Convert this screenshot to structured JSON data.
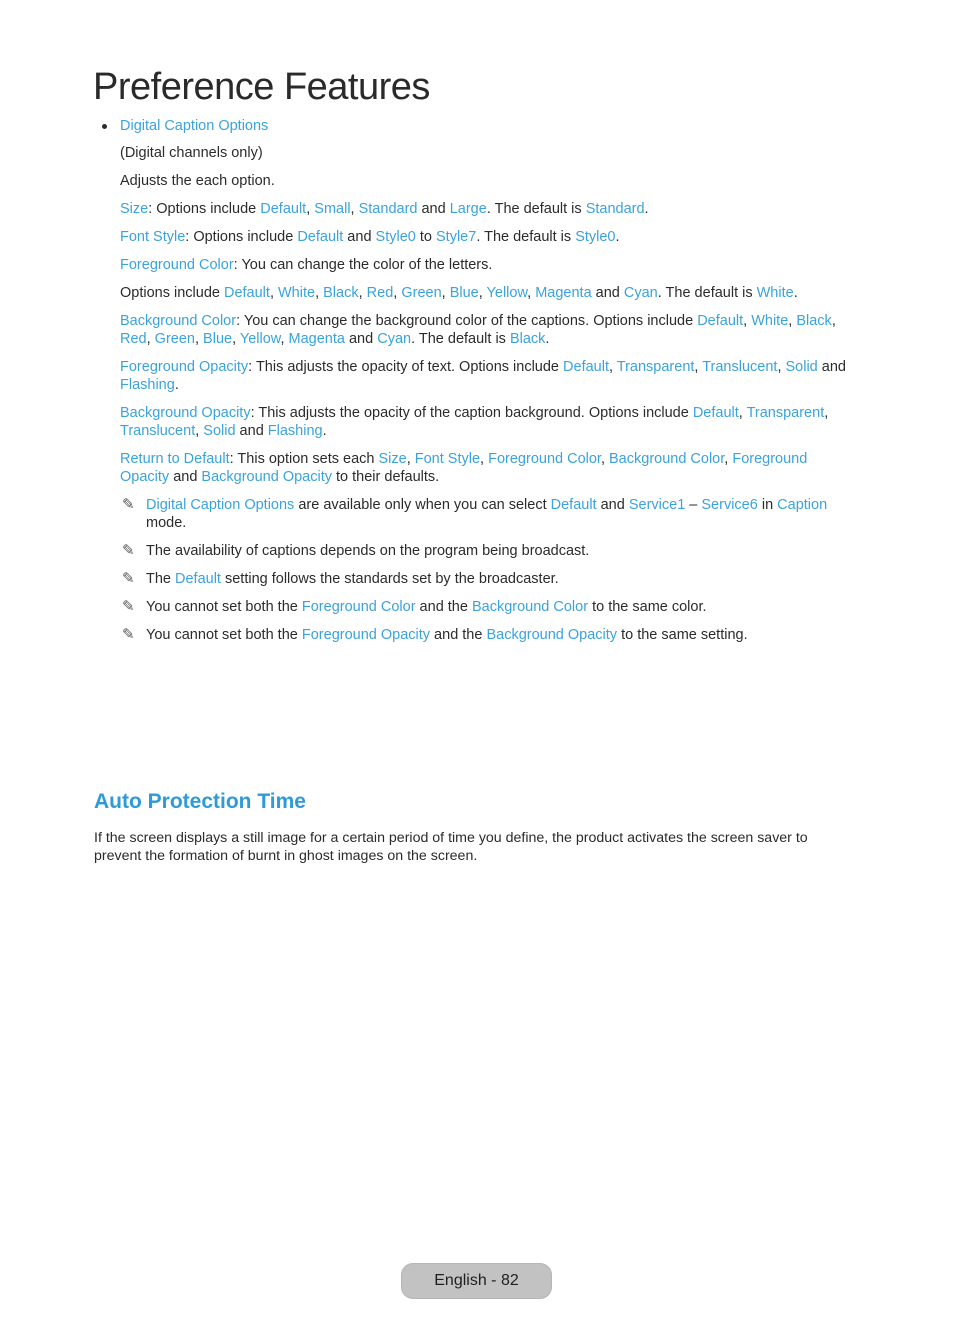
{
  "page": {
    "title": "Preference Features",
    "accent_color": "#3aa3dc",
    "heading_color": "#2f9ad8"
  },
  "bullet": {
    "label": "Digital Caption Options"
  },
  "paragraphs": [
    [
      {
        "t": "(Digital channels only)"
      }
    ],
    [
      {
        "t": "Adjusts the each option."
      }
    ],
    [
      {
        "t": "Size",
        "hl": true
      },
      {
        "t": ": Options include "
      },
      {
        "t": "Default",
        "hl": true
      },
      {
        "t": ", "
      },
      {
        "t": "Small",
        "hl": true
      },
      {
        "t": ", "
      },
      {
        "t": "Standard",
        "hl": true
      },
      {
        "t": " and "
      },
      {
        "t": "Large",
        "hl": true
      },
      {
        "t": ". The default is "
      },
      {
        "t": "Standard",
        "hl": true
      },
      {
        "t": "."
      }
    ],
    [
      {
        "t": "Font Style",
        "hl": true
      },
      {
        "t": ": Options include "
      },
      {
        "t": "Default",
        "hl": true
      },
      {
        "t": " and "
      },
      {
        "t": "Style0",
        "hl": true
      },
      {
        "t": " to "
      },
      {
        "t": "Style7",
        "hl": true
      },
      {
        "t": ". The default is "
      },
      {
        "t": "Style0",
        "hl": true
      },
      {
        "t": "."
      }
    ],
    [
      {
        "t": "Foreground Color",
        "hl": true
      },
      {
        "t": ": You can change the color of the letters."
      }
    ],
    [
      {
        "t": "Options include "
      },
      {
        "t": "Default",
        "hl": true
      },
      {
        "t": ", "
      },
      {
        "t": "White",
        "hl": true
      },
      {
        "t": ", "
      },
      {
        "t": "Black",
        "hl": true
      },
      {
        "t": ", "
      },
      {
        "t": "Red",
        "hl": true
      },
      {
        "t": ", "
      },
      {
        "t": "Green",
        "hl": true
      },
      {
        "t": ", "
      },
      {
        "t": "Blue",
        "hl": true
      },
      {
        "t": ", "
      },
      {
        "t": "Yellow",
        "hl": true
      },
      {
        "t": ", "
      },
      {
        "t": "Magenta",
        "hl": true
      },
      {
        "t": " and "
      },
      {
        "t": "Cyan",
        "hl": true
      },
      {
        "t": ". The default is "
      },
      {
        "t": "White",
        "hl": true
      },
      {
        "t": "."
      }
    ],
    [
      {
        "t": "Background Color",
        "hl": true
      },
      {
        "t": ": You can change the background color of the captions. Options include "
      },
      {
        "t": "Default",
        "hl": true
      },
      {
        "t": ", "
      },
      {
        "t": "White",
        "hl": true
      },
      {
        "t": ", "
      },
      {
        "t": "Black",
        "hl": true
      },
      {
        "t": ", "
      },
      {
        "t": "Red",
        "hl": true
      },
      {
        "t": ", "
      },
      {
        "t": "Green",
        "hl": true
      },
      {
        "t": ", "
      },
      {
        "t": "Blue",
        "hl": true
      },
      {
        "t": ", "
      },
      {
        "t": "Yellow",
        "hl": true
      },
      {
        "t": ", "
      },
      {
        "t": "Magenta",
        "hl": true
      },
      {
        "t": " and "
      },
      {
        "t": "Cyan",
        "hl": true
      },
      {
        "t": ". The default is "
      },
      {
        "t": "Black",
        "hl": true
      },
      {
        "t": "."
      }
    ],
    [
      {
        "t": "Foreground Opacity",
        "hl": true
      },
      {
        "t": ": This adjusts the opacity of text. Options include "
      },
      {
        "t": "Default",
        "hl": true
      },
      {
        "t": ", "
      },
      {
        "t": "Transparent",
        "hl": true
      },
      {
        "t": ", "
      },
      {
        "t": "Translucent",
        "hl": true
      },
      {
        "t": ", "
      },
      {
        "t": "Solid",
        "hl": true
      },
      {
        "t": " and "
      },
      {
        "t": "Flashing",
        "hl": true
      },
      {
        "t": "."
      }
    ],
    [
      {
        "t": "Background Opacity",
        "hl": true
      },
      {
        "t": ": This adjusts the opacity of the caption background. Options include "
      },
      {
        "t": "Default",
        "hl": true
      },
      {
        "t": ", "
      },
      {
        "t": "Transparent",
        "hl": true
      },
      {
        "t": ", "
      },
      {
        "t": "Translucent",
        "hl": true
      },
      {
        "t": ", "
      },
      {
        "t": "Solid",
        "hl": true
      },
      {
        "t": " and "
      },
      {
        "t": "Flashing",
        "hl": true
      },
      {
        "t": "."
      }
    ],
    [
      {
        "t": "Return to Default",
        "hl": true
      },
      {
        "t": ": This option sets each "
      },
      {
        "t": "Size",
        "hl": true
      },
      {
        "t": ", "
      },
      {
        "t": "Font Style",
        "hl": true
      },
      {
        "t": ", "
      },
      {
        "t": "Foreground Color",
        "hl": true
      },
      {
        "t": ", "
      },
      {
        "t": "Background Color",
        "hl": true
      },
      {
        "t": ", "
      },
      {
        "t": "Foreground Opacity",
        "hl": true
      },
      {
        "t": " and "
      },
      {
        "t": "Background Opacity",
        "hl": true
      },
      {
        "t": " to their defaults."
      }
    ]
  ],
  "notes": [
    [
      {
        "t": "Digital Caption Options",
        "hl": true
      },
      {
        "t": " are available only when you can select "
      },
      {
        "t": "Default",
        "hl": true
      },
      {
        "t": " and "
      },
      {
        "t": "Service1",
        "hl": true
      },
      {
        "t": " – "
      },
      {
        "t": "Service6",
        "hl": true
      },
      {
        "t": " in "
      },
      {
        "t": "Caption",
        "hl": true
      },
      {
        "t": " mode."
      }
    ],
    [
      {
        "t": "The availability of captions depends on the program being broadcast."
      }
    ],
    [
      {
        "t": "The "
      },
      {
        "t": "Default",
        "hl": true
      },
      {
        "t": " setting follows the standards set by the broadcaster."
      }
    ],
    [
      {
        "t": "You cannot set both the "
      },
      {
        "t": "Foreground Color",
        "hl": true
      },
      {
        "t": " and the "
      },
      {
        "t": "Background Color",
        "hl": true
      },
      {
        "t": " to the same color."
      }
    ],
    [
      {
        "t": "You cannot set both the "
      },
      {
        "t": "Foreground Opacity",
        "hl": true
      },
      {
        "t": " and the "
      },
      {
        "t": "Background Opacity",
        "hl": true
      },
      {
        "t": " to the same setting."
      }
    ]
  ],
  "note_icon": {
    "name": "pencil-note-icon",
    "glyph": "✎"
  },
  "section": {
    "heading": "Auto Protection Time",
    "body": "If the screen displays a still image for a certain period of time you define, the product activates the screen saver to prevent the formation of burnt in ghost images on the screen."
  },
  "footer": {
    "page_label": "English - 82"
  }
}
